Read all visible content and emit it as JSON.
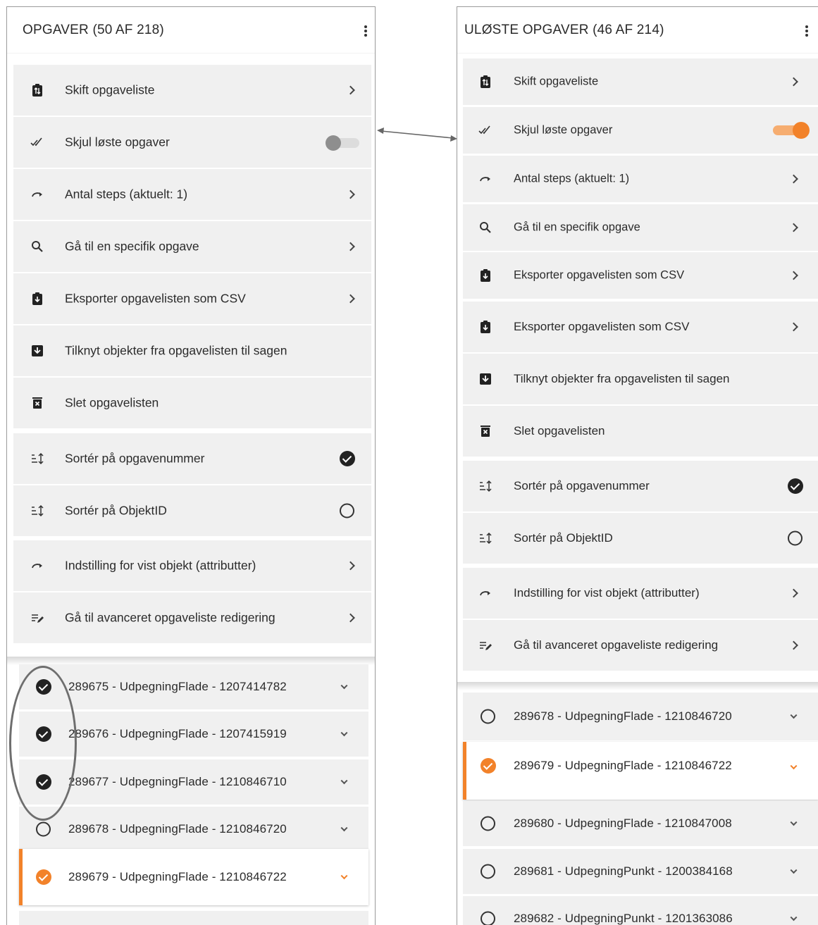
{
  "left_panel": {
    "title": "OPGAVER (50 AF 218)",
    "menu": {
      "switch_list": "Skift opgaveliste",
      "hide_solved": "Skjul løste opgaver",
      "hide_solved_on": false,
      "steps": "Antal steps (aktuelt: 1)",
      "goto_task": "Gå til en specifik opgave",
      "export_csv": "Eksporter opgavelisten som CSV",
      "attach_objects": "Tilknyt objekter fra opgavelisten til sagen",
      "delete_list": "Slet opgavelisten",
      "sort_task_number": "Sortér på opgavenummer",
      "sort_object_id": "Sortér på ObjektID",
      "display_settings": "Indstilling for vist objekt (attributter)",
      "advanced_edit": "Gå til avanceret opgaveliste redigering"
    },
    "tasks": [
      {
        "label": "289675 - UdpegningFlade - 1207414782",
        "status": "done"
      },
      {
        "label": "289676 - UdpegningFlade - 1207415919",
        "status": "done"
      },
      {
        "label": "289677 - UdpegningFlade - 1210846710",
        "status": "done"
      },
      {
        "label": "289678 - UdpegningFlade - 1210846720",
        "status": "open"
      },
      {
        "label": "289679 - UdpegningFlade - 1210846722",
        "status": "active"
      }
    ]
  },
  "right_panel": {
    "title": "ULØSTE OPGAVER (46 AF 214)",
    "menu": {
      "switch_list": "Skift opgaveliste",
      "hide_solved": "Skjul løste opgaver",
      "hide_solved_on": true,
      "steps": "Antal steps (aktuelt: 1)",
      "goto_task": "Gå til en specifik opgave",
      "export_csv_1": "Eksporter opgavelisten som CSV",
      "export_csv_2": "Eksporter opgavelisten som CSV",
      "attach_objects": "Tilknyt objekter fra opgavelisten til sagen",
      "delete_list": "Slet opgavelisten",
      "sort_task_number": "Sortér på opgavenummer",
      "sort_object_id": "Sortér på ObjektID",
      "display_settings": "Indstilling for vist objekt (attributter)",
      "advanced_edit": "Gå til avanceret opgaveliste redigering"
    },
    "tasks": [
      {
        "label": "289678 - UdpegningFlade - 1210846720",
        "status": "open"
      },
      {
        "label": "289679 - UdpegningFlade - 1210846722",
        "status": "active"
      },
      {
        "label": "289680 - UdpegningFlade - 1210847008",
        "status": "open"
      },
      {
        "label": "289681 - UdpegningPunkt - 1200384168",
        "status": "open"
      },
      {
        "label": "289682 - UdpegningPunkt - 1201363086",
        "status": "open"
      }
    ]
  },
  "colors": {
    "accent": "#f2822a",
    "row_bg": "#f0f0f0",
    "text": "#2b2b2b"
  },
  "icons": [
    "swap-list-icon",
    "double-check-icon",
    "redo-arrow-icon",
    "search-icon",
    "clipboard-download-icon",
    "download-box-icon",
    "delete-icon",
    "sort-icon",
    "edit-list-icon",
    "chevron-right-icon",
    "chevron-down-icon",
    "kebab-menu-icon"
  ]
}
